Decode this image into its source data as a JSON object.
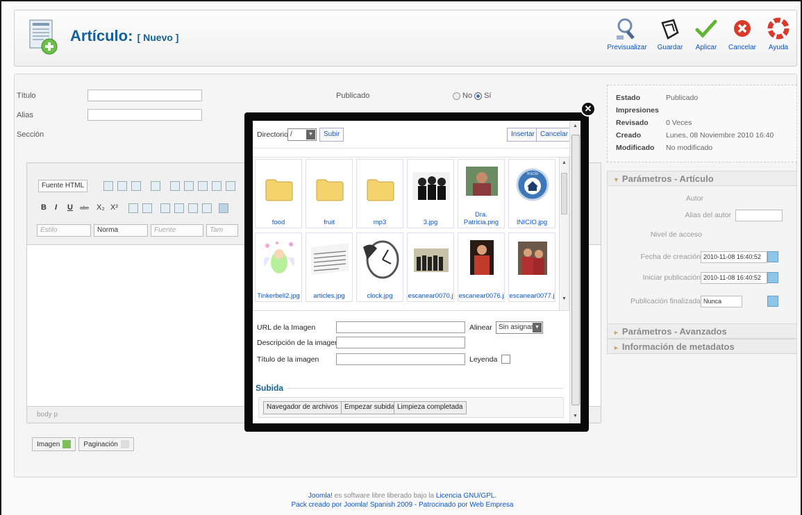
{
  "header": {
    "title": "Artículo:",
    "subtitle": "[ Nuevo ]",
    "toolbar": [
      {
        "label": "Previsualizar",
        "icon": "magnifier-icon"
      },
      {
        "label": "Guardar",
        "icon": "save-icon"
      },
      {
        "label": "Aplicar",
        "icon": "checkmark-icon"
      },
      {
        "label": "Cancelar",
        "icon": "cancel-icon"
      },
      {
        "label": "Ayuda",
        "icon": "help-lifebuoy-icon"
      }
    ]
  },
  "form": {
    "titulo_label": "Título",
    "alias_label": "Alias",
    "seccion_label": "Sección",
    "publicado_label": "Publicado",
    "no_label": "No",
    "si_label": "Sí"
  },
  "info": {
    "estado_k": "Estado",
    "estado_v": "Publicado",
    "impresiones_k": "Impresiones",
    "revisado_k": "Revisado",
    "revisado_v": "0 Veces",
    "creado_k": "Creado",
    "creado_v": "Lunes, 08 Noviembre 2010 16:40",
    "modificado_k": "Modificado",
    "modificado_v": "No modificado"
  },
  "params": {
    "articulo_title": "Parámetros - Artículo",
    "autor": "Autor",
    "alias_autor": "Alias del autor",
    "nivel_acceso": "Nivel de acceso",
    "fecha_creacion": "Fecha de creación",
    "fecha_creacion_v": "2010-11-08 16:40:52",
    "iniciar_pub": "Iniciar publicación",
    "iniciar_pub_v": "2010-11-08 16:40:52",
    "fin_pub": "Publicación finalizada",
    "fin_pub_v": "Nunca",
    "avanzados_title": "Parámetros - Avanzados",
    "metadatos_title": "Información de metadatos"
  },
  "editor": {
    "fuente_html": "Fuente HTML",
    "estilo": "Estilo",
    "norma": "Norma",
    "fuente": "Fuente",
    "tam": "Tam",
    "status": "body p"
  },
  "bottom": {
    "imagen": "Imagen",
    "paginacion": "Paginación"
  },
  "footer": {
    "line1_pre": "Joomla!",
    "line1_mid": "es software libre liberado bajo la",
    "line1_link": "Licencia GNU/GPL.",
    "line2": "Pack creado por Joomla! Spanish 2009 - Patrocinado por Web Empresa"
  },
  "modal": {
    "directorio_label": "Directorio",
    "directorio_value": "/",
    "subir": "Subir",
    "insertar": "Insertar",
    "cancelar": "Cancelar",
    "tiles": [
      {
        "caption": "food",
        "kind": "folder"
      },
      {
        "caption": "fruit",
        "kind": "folder"
      },
      {
        "caption": "mp3",
        "kind": "folder"
      },
      {
        "caption": "3.jpg",
        "kind": "photo"
      },
      {
        "caption": "Dra. Patricia.png",
        "kind": "photo"
      },
      {
        "caption": "INICIO.jpg",
        "kind": "photo"
      },
      {
        "caption": "Tinkerbell2.jpg",
        "kind": "photo"
      },
      {
        "caption": "articles.jpg",
        "kind": "photo"
      },
      {
        "caption": "clock.jpg",
        "kind": "photo"
      },
      {
        "caption": "escanear0070.j",
        "kind": "photo"
      },
      {
        "caption": "escanear0076.j",
        "kind": "photo"
      },
      {
        "caption": "escanear0077.j",
        "kind": "photo"
      }
    ],
    "url_label": "URL de la Imagen",
    "alinear_label": "Alinear",
    "alinear_value": "Sin asignar",
    "desc_label": "Descripción de la imagen",
    "titulo_label": "Título de la imagen",
    "leyenda_label": "Leyenda",
    "subida_label": "Subida",
    "nav_archivos": "Navegador de archivos",
    "empezar_subida": "Empezar subida",
    "limpieza": "Limpieza completada"
  }
}
